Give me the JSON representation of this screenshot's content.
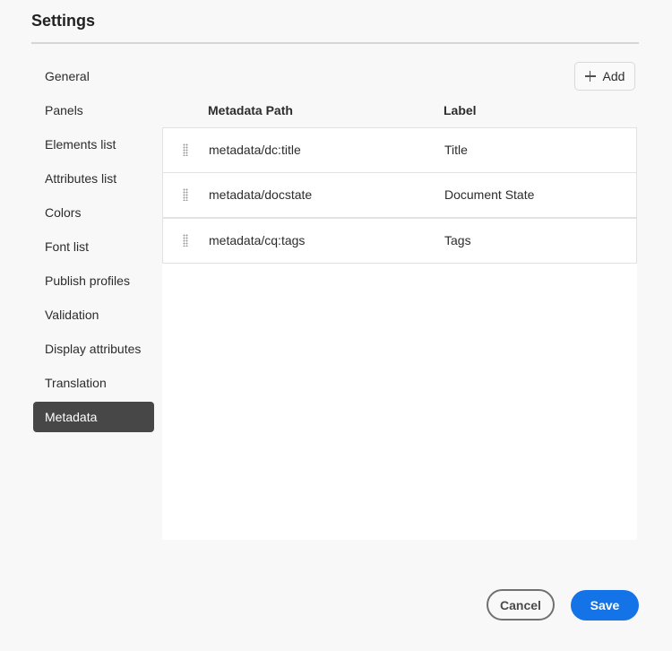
{
  "dialog": {
    "title": "Settings"
  },
  "nav": {
    "items": [
      {
        "label": "General"
      },
      {
        "label": "Panels"
      },
      {
        "label": "Elements list"
      },
      {
        "label": "Attributes list"
      },
      {
        "label": "Colors"
      },
      {
        "label": "Font list"
      },
      {
        "label": "Publish profiles"
      },
      {
        "label": "Validation"
      },
      {
        "label": "Display attributes"
      },
      {
        "label": "Translation"
      },
      {
        "label": "Metadata"
      }
    ],
    "active": "Metadata"
  },
  "toolbar": {
    "add_label": "Add",
    "add_icon": "plus-icon"
  },
  "table": {
    "columns": [
      "Metadata Path",
      "Label"
    ],
    "rows": [
      {
        "path": "metadata/dc:title",
        "label": "Title"
      },
      {
        "path": "metadata/docstate",
        "label": "Document State"
      },
      {
        "path": "metadata/cq:tags",
        "label": "Tags"
      }
    ],
    "row_icon": "drag-handle-icon"
  },
  "footer": {
    "cancel_label": "Cancel",
    "save_label": "Save"
  },
  "colors": {
    "accent": "#1473e6",
    "active_nav": "#474747"
  }
}
